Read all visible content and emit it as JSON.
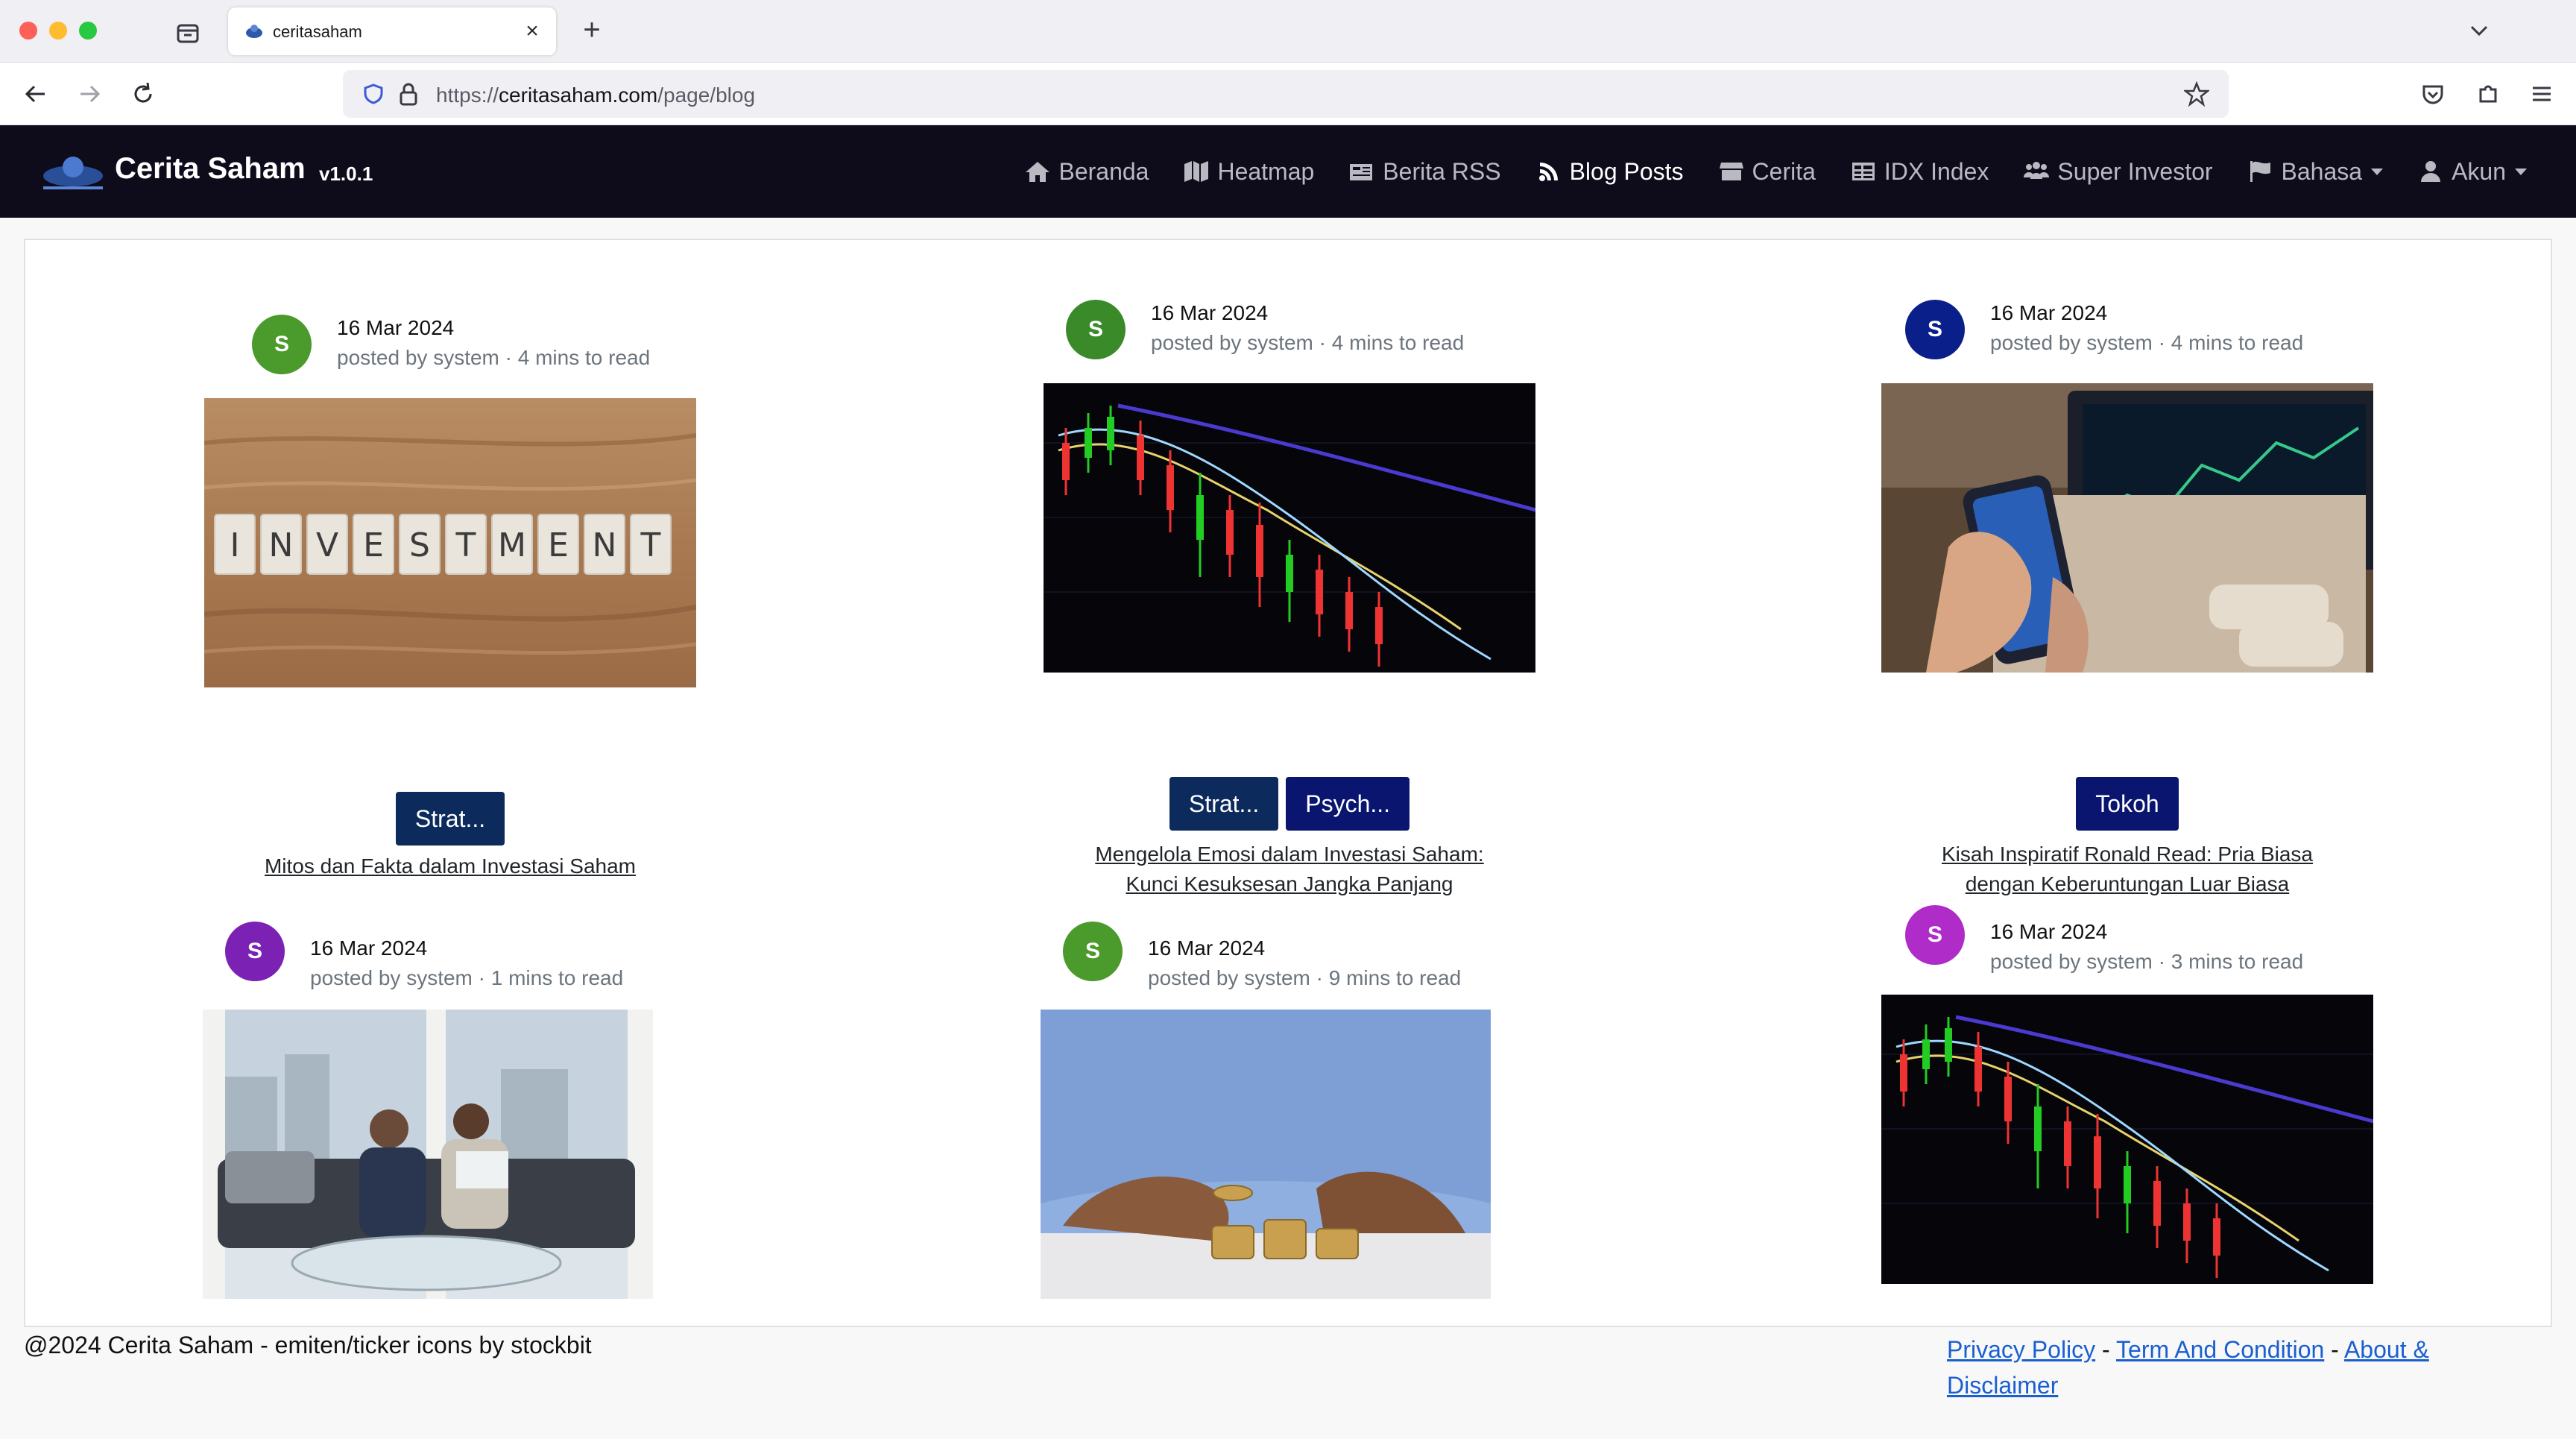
{
  "browser": {
    "tab_title": "ceritasaham",
    "url_prefix": "https://",
    "url_host": "ceritasaham.com",
    "url_path": "/page/blog"
  },
  "site": {
    "brand_name": "Cerita Saham",
    "version": "v1.0.1",
    "menu": [
      {
        "label": "Beranda",
        "icon": "home-icon"
      },
      {
        "label": "Heatmap",
        "icon": "map-icon"
      },
      {
        "label": "Berita RSS",
        "icon": "newspaper-icon"
      },
      {
        "label": "Blog Posts",
        "icon": "blog-icon",
        "active": true
      },
      {
        "label": "Cerita",
        "icon": "store-icon"
      },
      {
        "label": "IDX Index",
        "icon": "table-icon"
      },
      {
        "label": "Super Investor",
        "icon": "users-icon"
      },
      {
        "label": "Bahasa",
        "icon": "flag-icon"
      },
      {
        "label": "Akun",
        "icon": "user-icon"
      }
    ]
  },
  "posts": [
    {
      "avatar": "S",
      "avatar_color": "#4a9a2c",
      "date": "16 Mar 2024",
      "meta": "posted by system · 4 mins to read",
      "tags": [
        "Strat..."
      ],
      "title_lines": [
        "Mitos dan Fakta dalam Investasi Saham"
      ],
      "image": "investment-blocks-image"
    },
    {
      "avatar": "S",
      "avatar_color": "#3a8a2a",
      "date": "16 Mar 2024",
      "meta": "posted by system · 4 mins to read",
      "tags": [
        "Strat...",
        "Psych..."
      ],
      "title_lines": [
        "Mengelola Emosi dalam Investasi Saham:",
        "Kunci Kesuksesan Jangka Panjang"
      ],
      "image": "candlestick-chart-image"
    },
    {
      "avatar": "S",
      "avatar_color": "#0a1f8a",
      "date": "16 Mar 2024",
      "meta": "posted by system · 4 mins to read",
      "tags": [
        "Tokoh"
      ],
      "title_lines": [
        "Kisah Inspiratif Ronald Read: Pria Biasa",
        "dengan Keberuntungan Luar Biasa"
      ],
      "image": "phone-trading-image"
    },
    {
      "avatar": "S",
      "avatar_color": "#7b22b5",
      "date": "16 Mar 2024",
      "meta": "posted by system · 1 mins to read",
      "tags": [],
      "title_lines": [],
      "image": "office-meeting-image"
    },
    {
      "avatar": "S",
      "avatar_color": "#4a9a2c",
      "date": "16 Mar 2024",
      "meta": "posted by system · 9 mins to read",
      "tags": [],
      "title_lines": [],
      "image": "coins-stack-image"
    },
    {
      "avatar": "S",
      "avatar_color": "#b02cc8",
      "date": "16 Mar 2024",
      "meta": "posted by system · 3 mins to read",
      "tags": [],
      "title_lines": [],
      "image": "candlestick-chart-image"
    }
  ],
  "footer": {
    "copyright": "@2024 Cerita Saham - emiten/ticker icons by stockbit",
    "links": [
      "Privacy Policy",
      "Term And Condition",
      "About &",
      "Disclaimer"
    ],
    "separator": "-"
  }
}
